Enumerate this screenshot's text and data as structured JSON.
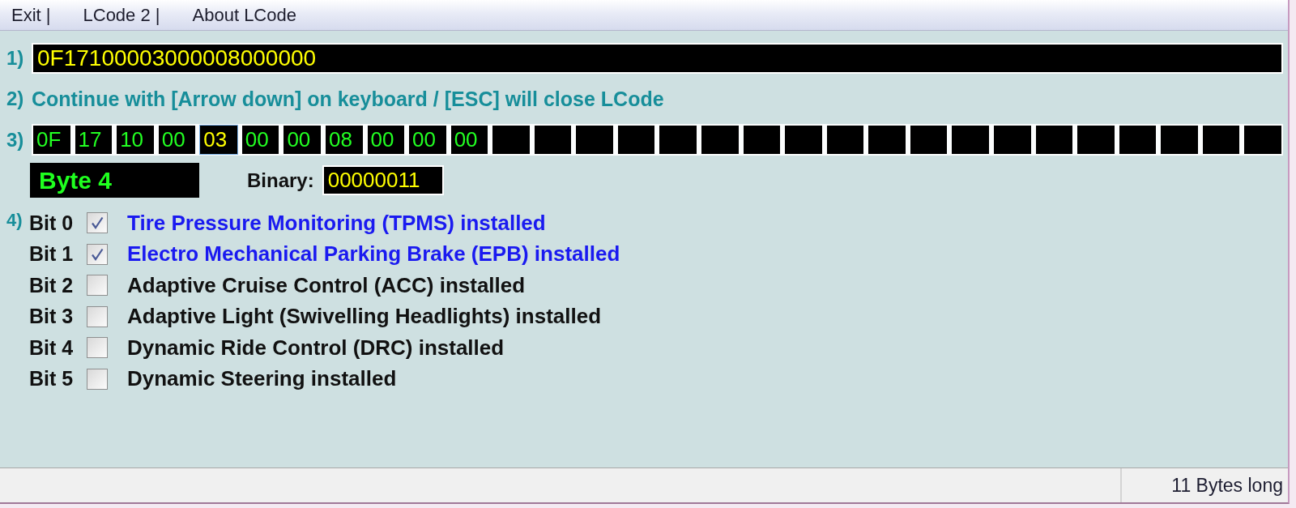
{
  "menu_bar": {
    "items": [
      "Exit |",
      "LCode 2 |",
      "About LCode"
    ]
  },
  "coding": {
    "number": "1)",
    "value": "0F17100003000008000000"
  },
  "instruction": {
    "number": "2)",
    "text": "Continue with [Arrow down] on keyboard / [ESC] will close LCode"
  },
  "bytes": {
    "number": "3)",
    "slots": [
      {
        "value": "0F",
        "selected": false
      },
      {
        "value": "17",
        "selected": false
      },
      {
        "value": "10",
        "selected": false
      },
      {
        "value": "00",
        "selected": false
      },
      {
        "value": "03",
        "selected": true
      },
      {
        "value": "00",
        "selected": false
      },
      {
        "value": "00",
        "selected": false
      },
      {
        "value": "08",
        "selected": false
      },
      {
        "value": "00",
        "selected": false
      },
      {
        "value": "00",
        "selected": false
      },
      {
        "value": "00",
        "selected": false
      },
      {
        "selected": false
      },
      {
        "selected": false
      },
      {
        "selected": false
      },
      {
        "selected": false
      },
      {
        "selected": false
      },
      {
        "selected": false
      },
      {
        "selected": false
      },
      {
        "selected": false
      },
      {
        "selected": false
      },
      {
        "selected": false
      },
      {
        "selected": false
      },
      {
        "selected": false
      },
      {
        "selected": false
      },
      {
        "selected": false
      },
      {
        "selected": false
      },
      {
        "selected": false
      },
      {
        "selected": false
      },
      {
        "selected": false
      },
      {
        "selected": false
      }
    ]
  },
  "byte_info": {
    "byte": "Byte 4",
    "binary_label": "Binary:",
    "binary": "00000011"
  },
  "bits": {
    "number": "4)",
    "items": [
      {
        "bit": "Bit 0",
        "checked": true,
        "label": "Tire Pressure Monitoring (TPMS) installed"
      },
      {
        "bit": "Bit 1",
        "checked": true,
        "label": "Electro Mechanical Parking Brake (EPB) installed"
      },
      {
        "bit": "Bit 2",
        "checked": false,
        "label": "Adaptive Cruise Control (ACC) installed"
      },
      {
        "bit": "Bit 3",
        "checked": false,
        "label": "Adaptive Light (Swivelling Headlights) installed"
      },
      {
        "bit": "Bit 4",
        "checked": false,
        "label": "Dynamic Ride Control (DRC) installed"
      },
      {
        "bit": "Bit 5",
        "checked": false,
        "label": "Dynamic Steering installed"
      }
    ]
  },
  "status_bar": {
    "text": "11 Bytes long"
  }
}
